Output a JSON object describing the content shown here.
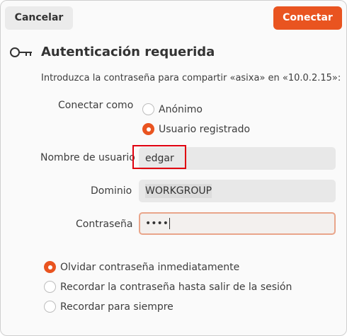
{
  "header": {
    "cancel_label": "Cancelar",
    "connect_label": "Conectar"
  },
  "dialog": {
    "title": "Autenticación requerida",
    "description": "Introduzca la contraseña para compartir «asixa» en «10.0.2.15»:",
    "icon": "key-icon"
  },
  "connect_as": {
    "label": "Conectar como",
    "options": [
      {
        "label": "Anónimo",
        "selected": false
      },
      {
        "label": "Usuario registrado",
        "selected": true
      }
    ]
  },
  "fields": {
    "username_label": "Nombre de usuario",
    "username_value": "edgar",
    "domain_label": "Dominio",
    "domain_value": "WORKGROUP",
    "password_label": "Contraseña",
    "password_mask": "••••"
  },
  "remember": {
    "options": [
      {
        "label": "Olvidar contraseña inmediatamente",
        "selected": true
      },
      {
        "label": "Recordar la contraseña hasta salir de la sesión",
        "selected": false
      },
      {
        "label": "Recordar para siempre",
        "selected": false
      }
    ]
  },
  "colors": {
    "accent": "#e95420",
    "highlight": "#e0000f"
  }
}
